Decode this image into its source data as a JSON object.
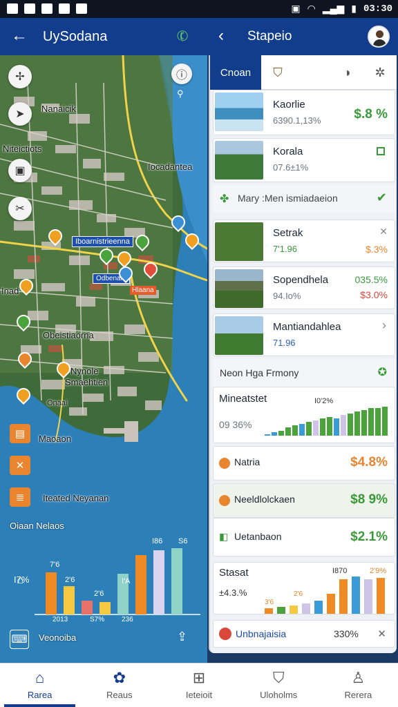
{
  "status_bar": {
    "time": "03:30"
  },
  "header": {
    "left_title": "UySodana",
    "right_title": "Stapeio"
  },
  "map": {
    "labels": [
      "Nanaicik",
      "Niteictiots",
      "Iocadantea",
      "Iboarnistrieenna",
      "Inad",
      "Obeistiaorna",
      "Nynole",
      "Smaehtien",
      "Maoaon",
      "Iteated Neyanan",
      "Oiaan Nelaos",
      "Veonoiba",
      "Onaai"
    ],
    "small_boxes": [
      "Odbenam",
      "Hlaana"
    ],
    "chart": {
      "type": "bar",
      "labels_top": [
        "I86",
        "S6",
        "7'6",
        "2'6",
        "I'A"
      ],
      "labels_left": [
        "I7%"
      ],
      "labels_bottom": [
        "2013",
        "S7%",
        "236"
      ],
      "label_mid": "2'6",
      "values": [
        62,
        42,
        20,
        18,
        60,
        88,
        95,
        98
      ],
      "colors": [
        "#f08a24",
        "#f5c842",
        "#e5736a",
        "#f5c842",
        "#8fd3c8",
        "#f08a24",
        "#d9d4f0",
        "#8fd3c8"
      ]
    }
  },
  "panel": {
    "tabs": [
      "Cnoan"
    ],
    "cards": [
      {
        "title": "Kaorlie",
        "sub": "6390.1,13%",
        "value": "$.8 %"
      },
      {
        "title": "Korala",
        "sub": "07.6±1%"
      },
      {
        "title": "Mary :Men ismiadaeion"
      },
      {
        "title": "Setrak",
        "sub": "7'1.96",
        "value": "$.3%"
      },
      {
        "title": "Sopendhela",
        "sub": "94.Io%",
        "value": "$3.0%",
        "value_top": "035.5%"
      },
      {
        "title": "Mantiandahlea",
        "sub": "71.96"
      }
    ],
    "section_title": "Neon Hga Frmony",
    "metric": {
      "title": "Mineatstet",
      "sub": "09 36%",
      "label": "I0'2%",
      "bars": [
        2,
        4,
        6,
        10,
        12,
        14,
        16,
        18,
        20,
        22,
        20,
        24,
        26,
        28,
        30,
        32,
        32,
        34
      ],
      "colors": [
        "#3b9bd6",
        "#3b9bd6",
        "#4aa33b",
        "#4aa33b",
        "#4aa33b",
        "#3b9bd6",
        "#4aa33b",
        "#cfc4e8",
        "#4aa33b",
        "#4aa33b",
        "#3b9bd6",
        "#cfc4e8",
        "#4aa33b",
        "#4aa33b",
        "#4aa33b",
        "#4aa33b",
        "#4aa33b",
        "#4aa33b"
      ]
    },
    "rows": [
      {
        "title": "Natria",
        "value": "$4.8%",
        "color": "#e8852e"
      },
      {
        "title": "Neeldlolckaen",
        "value": "$8 9%",
        "color": "#3a9a3a"
      },
      {
        "title": "Uetanbaon",
        "value": "$2.1%",
        "color": "#3a9a3a"
      }
    ],
    "stats": {
      "title": "Stasat",
      "value": "±4.3.%",
      "labels": [
        "I870",
        "2'9%",
        "3'6",
        "2'6"
      ],
      "bars": [
        8,
        10,
        12,
        14,
        18,
        28,
        48,
        52,
        48,
        50
      ],
      "colors": [
        "#f08a24",
        "#4aa33b",
        "#f5c842",
        "#cfc4e8",
        "#3b9bd6",
        "#f08a24",
        "#f08a24",
        "#3b9bd6",
        "#cfc4e8",
        "#f08a24"
      ]
    },
    "footer": {
      "title": "Unbnajaisia",
      "value": "330%"
    }
  },
  "bottom_nav": [
    "Rarea",
    "Reaus",
    "Ieteioit",
    "Uloholms",
    "Rerera"
  ]
}
